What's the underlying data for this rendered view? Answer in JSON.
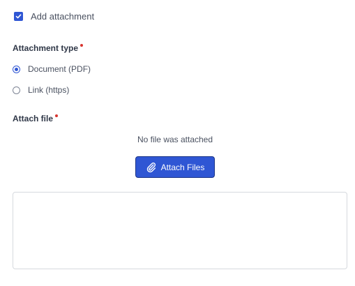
{
  "add_attachment": {
    "label": "Add attachment",
    "checked": true
  },
  "attachment_type": {
    "label": "Attachment type",
    "required": true,
    "options": [
      {
        "label": "Document (PDF)",
        "selected": true
      },
      {
        "label": "Link (https)",
        "selected": false
      }
    ]
  },
  "attach_file": {
    "label": "Attach file",
    "required": true,
    "status_text": "No file was attached",
    "button_label": "Attach Files",
    "button_icon": "paperclip-icon"
  },
  "colors": {
    "accent": "#2f56d4",
    "required": "#d8342f",
    "border": "#d6d9de"
  }
}
